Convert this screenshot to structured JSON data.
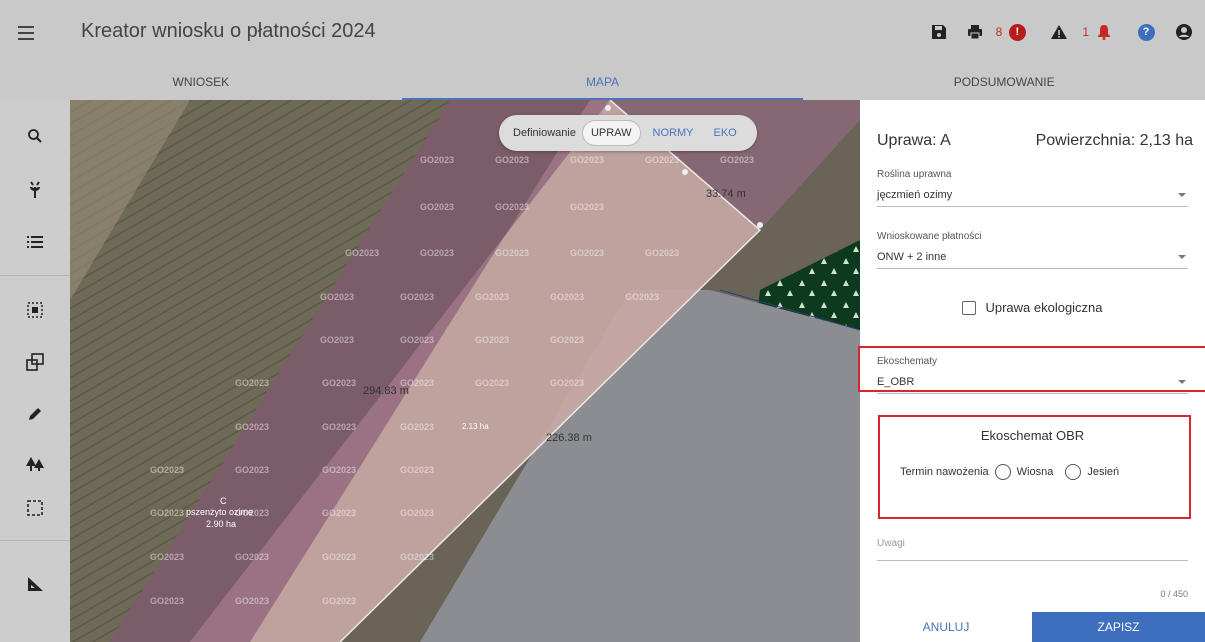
{
  "app": {
    "title": "Kreator wniosku o płatności 2024",
    "counts": {
      "errors": "8",
      "warnings": "1"
    }
  },
  "tabs": [
    {
      "label": "WNIOSEK"
    },
    {
      "label": "MAPA"
    },
    {
      "label": "PODSUMOWANIE"
    }
  ],
  "left_tools": [
    "search-icon",
    "plant-icon",
    "list-icon",
    "select-area-icon",
    "layers-icon",
    "edit-pencil-icon",
    "trees-icon",
    "crop-frame-icon",
    "measure-icon"
  ],
  "map": {
    "mode_label": "Definiowanie",
    "chips": [
      "UPRAW",
      "NORMY",
      "EKO"
    ],
    "active_chip": "UPRAW",
    "watermark": "GO2023",
    "dimension_labels": [
      "33.74 m",
      "294.83 m",
      "226.38 m"
    ],
    "area_label": "2.13 ha",
    "parcel_c": {
      "letter": "C",
      "crop": "pszenżyto ozime",
      "area": "2.90 ha"
    }
  },
  "panel": {
    "crop_header": "Uprawa: A",
    "area_header": "Powierzchnia: 2,13 ha",
    "crop_field": {
      "label": "Roślina uprawna",
      "value": "jęczmień ozimy"
    },
    "payments_field": {
      "label": "Wnioskowane płatności",
      "value": "ONW + 2 inne"
    },
    "organic_checkbox": "Uprawa ekologiczna",
    "ecoschemes_field": {
      "label": "Ekoschematy",
      "value": "E_OBR"
    },
    "obr": {
      "title": "Ekoschemat OBR",
      "question": "Termin nawożenia",
      "option_spring": "Wiosna",
      "option_autumn": "Jesień"
    },
    "notes": {
      "placeholder": "Uwagi",
      "counter": "0 / 450"
    },
    "cancel_label": "ANULUJ",
    "save_label": "ZAPISZ"
  },
  "colors": {
    "accent": "#4a74b9",
    "save_button": "#3e6fbf",
    "highlight_border": "#d8262f",
    "error": "#c62828"
  }
}
